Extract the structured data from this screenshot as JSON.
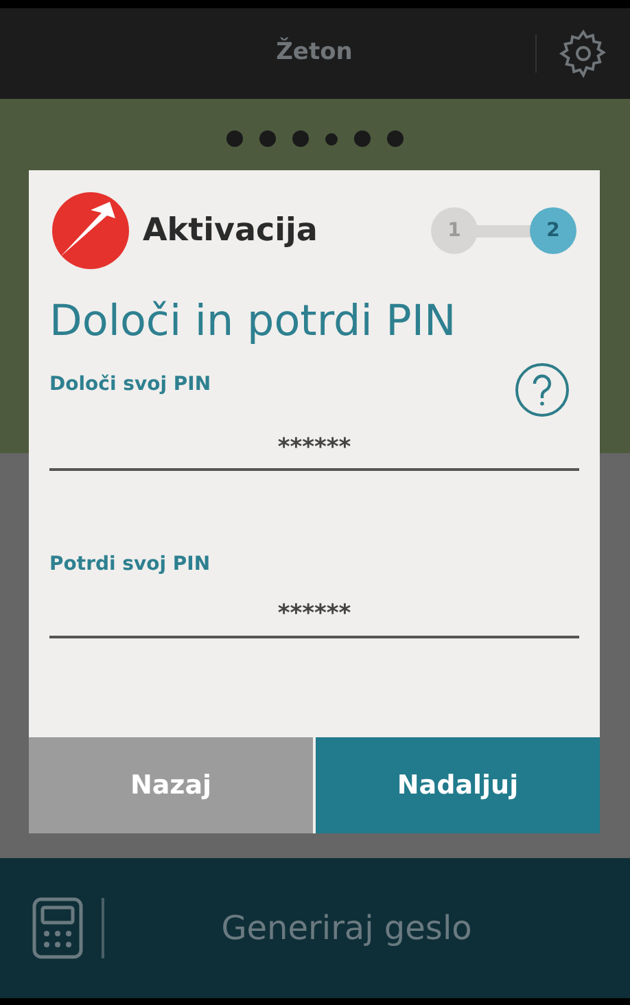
{
  "header": {
    "title": "Žeton"
  },
  "page_dots": [
    {
      "selected": false
    },
    {
      "selected": false
    },
    {
      "selected": false
    },
    {
      "selected": true
    },
    {
      "selected": false
    },
    {
      "selected": false
    }
  ],
  "dialog": {
    "title": "Aktivacija",
    "steps": [
      {
        "label": "1",
        "selected": false
      },
      {
        "label": "2",
        "selected": true
      }
    ],
    "heading": "Določi in potrdi PIN",
    "help_button": true,
    "fields": [
      {
        "label": "Določi svoj PIN",
        "value": "******"
      },
      {
        "label": "Potrdi svoj PIN",
        "value": "******"
      }
    ],
    "buttons": [
      {
        "label": "Nazaj",
        "kind": "secondary"
      },
      {
        "label": "Nadaljuj",
        "kind": "primary"
      }
    ]
  },
  "bottom_bar": {
    "label": "Generiraj geslo"
  }
}
